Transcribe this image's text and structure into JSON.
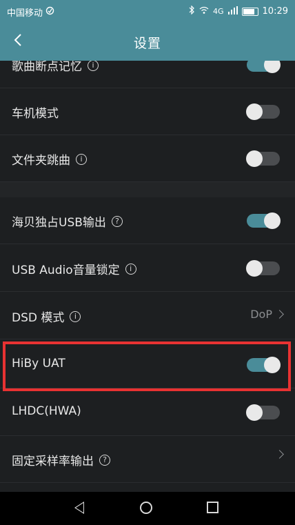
{
  "status_bar": {
    "carrier": "中国移动",
    "carrier_icon": "sync-icon",
    "network_type": "4G",
    "time": "10:29"
  },
  "header": {
    "title": "设置",
    "back_icon": "chevron-left-icon"
  },
  "settings": {
    "resume_playback": {
      "label": "歌曲断点记忆",
      "state": "on"
    },
    "car_mode": {
      "label": "车机模式",
      "state": "off"
    },
    "folder_skip": {
      "label": "文件夹跳曲",
      "state": "off"
    },
    "hiby_exclusive_usb": {
      "label": "海贝独占USB输出",
      "state": "on"
    },
    "usb_audio_volume_lock": {
      "label": "USB Audio音量锁定",
      "state": "off"
    },
    "dsd_mode": {
      "label": "DSD 模式",
      "value": "DoP"
    },
    "hiby_uat": {
      "label": "HiBy UAT",
      "state": "on",
      "highlight_color": "#e83232"
    },
    "lhdc": {
      "label": "LHDC(HWA)",
      "state": "off"
    },
    "fixed_sample_rate": {
      "label": "固定采样率输出"
    }
  },
  "icons": {
    "info": "i",
    "question": "?"
  },
  "colors": {
    "accent": "#4a8c99",
    "background": "#1d1f21",
    "highlight": "#e83232"
  }
}
